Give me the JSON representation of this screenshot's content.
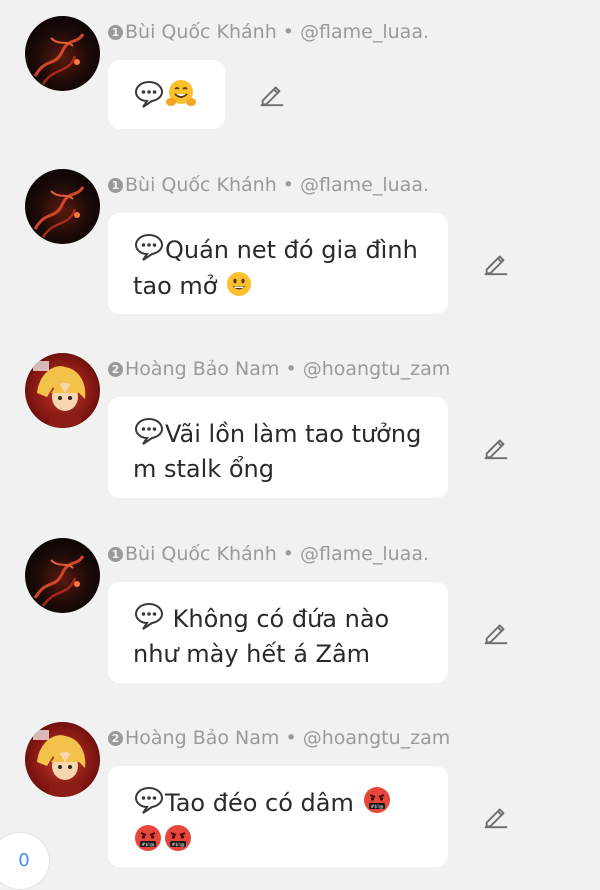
{
  "messages": [
    {
      "author_rank": "1",
      "author_name": "Bùi Quốc Khánh",
      "separator": "•",
      "author_handle": "@flame_luaa.",
      "text": "",
      "emojis": [
        "speech-balloon",
        "hugging-face"
      ],
      "avatar": "fire-avatar"
    },
    {
      "author_rank": "1",
      "author_name": "Bùi Quốc Khánh",
      "separator": "•",
      "author_handle": "@flame_luaa.",
      "line1": "Quán net đó gia đình",
      "line2": "tao mở",
      "avatar": "fire-avatar"
    },
    {
      "author_rank": "2",
      "author_name": "Hoàng Bảo Nam",
      "separator": "•",
      "author_handle": "@hoangtu_zam",
      "line1": "Vãi lồn làm tao tưởng",
      "line2": "m stalk ổng",
      "avatar": "anime-avatar"
    },
    {
      "author_rank": "1",
      "author_name": "Bùi Quốc Khánh",
      "separator": "•",
      "author_handle": "@flame_luaa.",
      "line1": " Không có đứa nào",
      "line2": "như mày hết á Zâm",
      "avatar": "fire-avatar"
    },
    {
      "author_rank": "2",
      "author_name": "Hoàng Bảo Nam",
      "separator": "•",
      "author_handle": "@hoangtu_zam",
      "line1": "Tao đéo có dâm",
      "line2": "",
      "avatar": "anime-avatar"
    }
  ],
  "counter": "0",
  "colors": {
    "background": "#f1f1f1",
    "bubble": "#ffffff",
    "meta_text": "#9a9a9a",
    "body_text": "#2a2a2a",
    "counter_text": "#3d8df5"
  }
}
